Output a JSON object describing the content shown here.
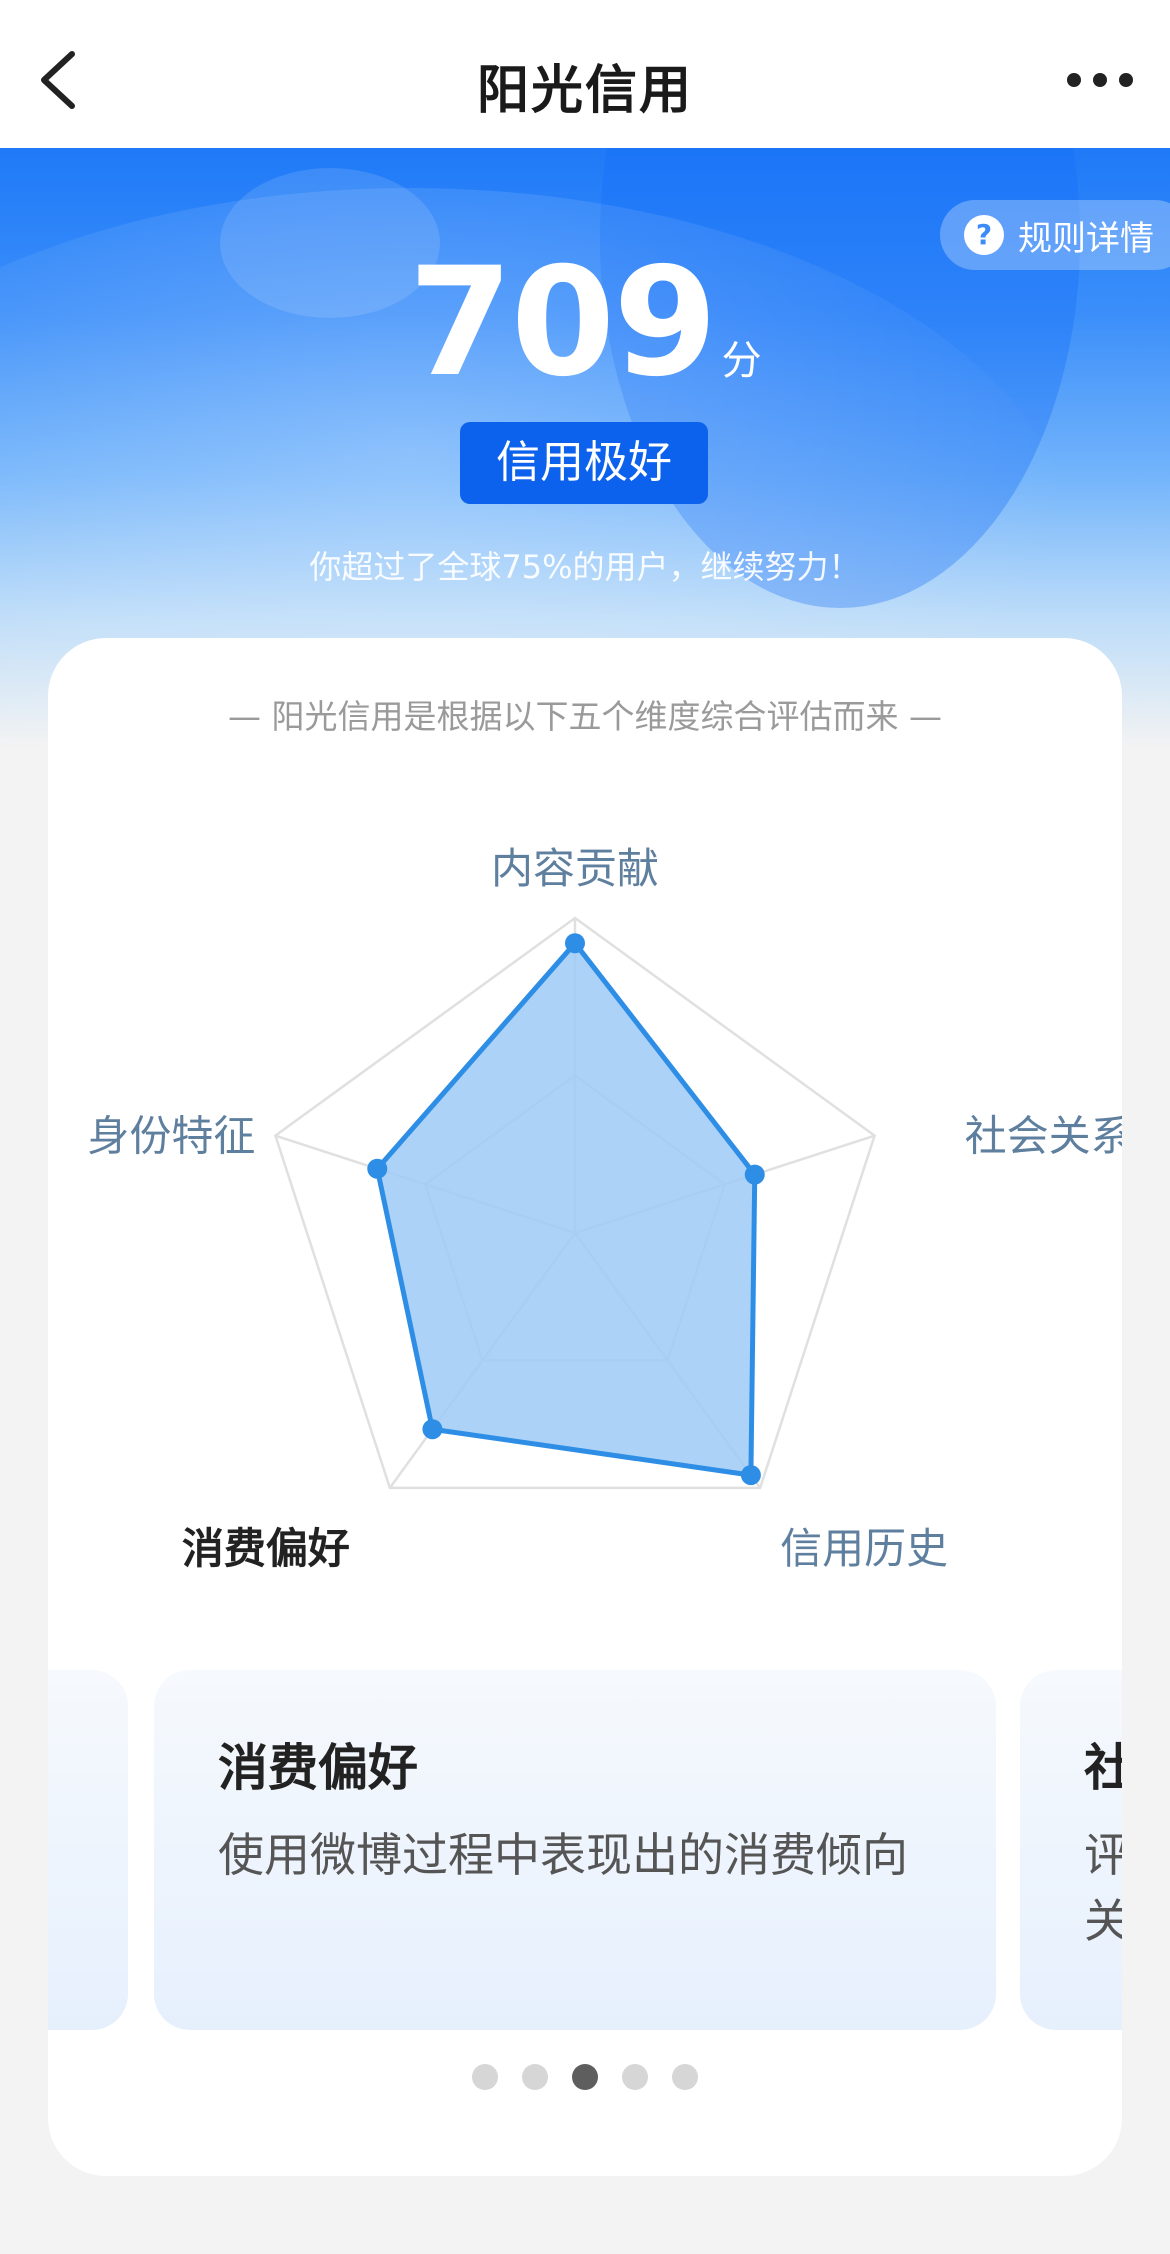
{
  "nav": {
    "title": "阳光信用"
  },
  "hero": {
    "rules_label": "规则详情",
    "rules_icon": "help-circle-icon",
    "score": "709",
    "score_unit": "分",
    "level": "信用极好",
    "rank_text": "你超过了全球75%的用户，继续努力！"
  },
  "card": {
    "subtitle": "— 阳光信用是根据以下五个维度综合评估而来 —"
  },
  "chart_data": {
    "type": "radar",
    "axes": [
      "内容贡献",
      "社会关系",
      "信用历史",
      "消费偏好",
      "身份特征"
    ],
    "values": [
      0.92,
      0.6,
      0.95,
      0.77,
      0.66
    ],
    "max": 1,
    "selected_axis": "消费偏好",
    "colors": {
      "fill": "#9ecbf6",
      "stroke": "#2e8ee6",
      "grid": "#e0e0e0",
      "label": "#5f7f9f",
      "label_active": "#222222"
    }
  },
  "carousel": {
    "prev_title": "",
    "prev_desc": "",
    "main_title": "消费偏好",
    "main_desc": "使用微博过程中表现出的消费倾向",
    "next_title": "社",
    "next_desc": "评\n关",
    "dot_count": 5,
    "active_dot": 2
  }
}
